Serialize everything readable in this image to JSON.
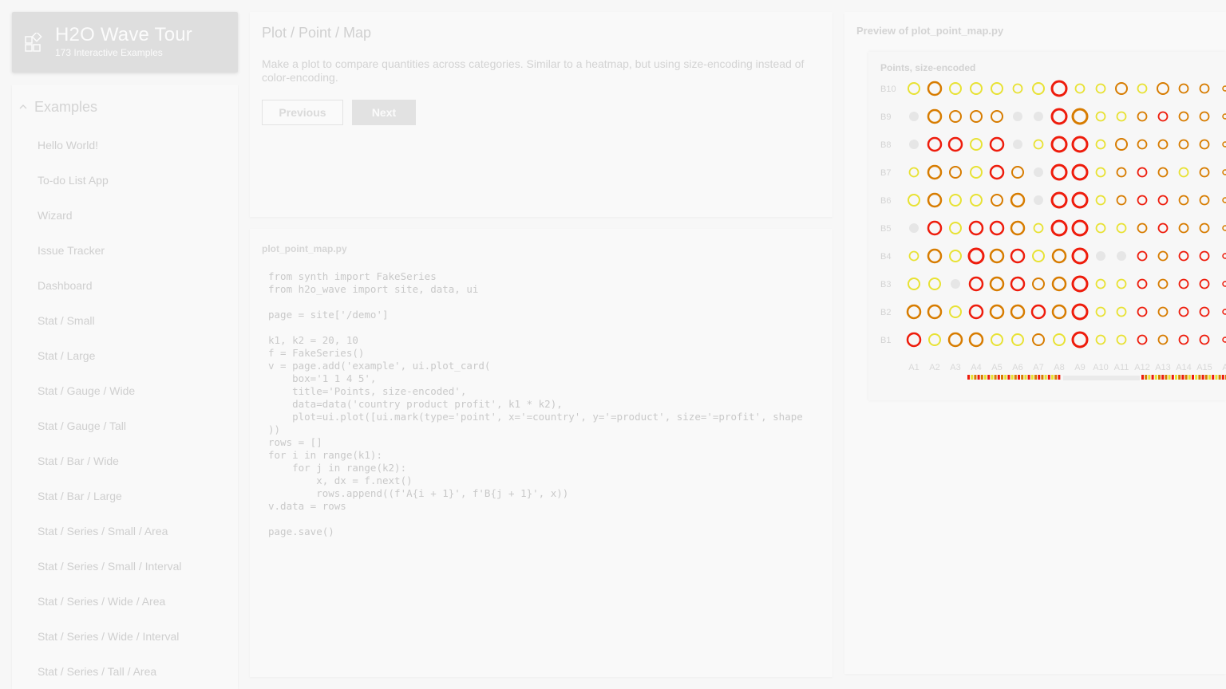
{
  "sidebar": {
    "title": "H2O Wave Tour",
    "subtitle": "173 Interactive Examples",
    "group_label": "Examples",
    "items": [
      "Hello World!",
      "To-do List App",
      "Wizard",
      "Issue Tracker",
      "Dashboard",
      "Stat / Small",
      "Stat / Large",
      "Stat / Gauge / Wide",
      "Stat / Gauge / Tall",
      "Stat / Bar / Wide",
      "Stat / Bar / Large",
      "Stat / Series / Small / Area",
      "Stat / Series / Small / Interval",
      "Stat / Series / Wide / Area",
      "Stat / Series / Wide / Interval",
      "Stat / Series / Tall / Area"
    ]
  },
  "intro": {
    "title": "Plot / Point / Map",
    "description": "Make a plot to compare quantities across categories. Similar to a heatmap, but using size-encoding instead of color-encoding.",
    "prev_label": "Previous",
    "next_label": "Next"
  },
  "code": {
    "filename": "plot_point_map.py",
    "lines": [
      "from synth import FakeSeries",
      "from h2o_wave import site, data, ui",
      "",
      "page = site['/demo']",
      "",
      "k1, k2 = 20, 10",
      "f = FakeSeries()",
      "v = page.add('example', ui.plot_card(",
      "    box='1 1 4 5',",
      "    title='Points, size-encoded',",
      "    data=data('country product profit', k1 * k2),",
      "    plot=ui.plot([ui.mark(type='point', x='=country', y='=product', size='=profit', shape",
      "))",
      "rows = []",
      "for i in range(k1):",
      "    for j in range(k2):",
      "        x, dx = f.next()",
      "        rows.append((f'A{i + 1}', f'B{j + 1}', x))",
      "v.data = rows",
      "",
      "page.save()"
    ]
  },
  "preview": {
    "label": "Preview of plot_point_map.py",
    "plot_title": "Points, size-encoded"
  },
  "colors": {
    "mark_red": "#ee1c0c",
    "mark_orange": "#d77c00",
    "mark_yellow": "#e8e234",
    "mark_gray": "#e6e6e6"
  },
  "chart_data": {
    "type": "scatter",
    "title": "Points, size-encoded",
    "x_categories": [
      "A1",
      "A2",
      "A3",
      "A4",
      "A5",
      "A6",
      "A7",
      "A8",
      "A9",
      "A10",
      "A11",
      "A12",
      "A13",
      "A14",
      "A15",
      "A16"
    ],
    "y_categories": [
      "B10",
      "B9",
      "B8",
      "B7",
      "B6",
      "B5",
      "B4",
      "B3",
      "B2",
      "B1"
    ],
    "visible_x_labels": [
      "A1",
      "A2",
      "A3",
      "A4",
      "A5",
      "A6",
      "A7",
      "A8",
      "A9",
      "A10",
      "A11",
      "A12",
      "A13",
      "A14",
      "A15",
      "A"
    ],
    "size_levels": [
      [
        3,
        4,
        3,
        3,
        3,
        2,
        3,
        5,
        2,
        2,
        3,
        2,
        3,
        2,
        2,
        1
      ],
      [
        1,
        4,
        3,
        3,
        3,
        1,
        1,
        5,
        5,
        2,
        2,
        2,
        2,
        2,
        2,
        1
      ],
      [
        1,
        4,
        4,
        3,
        4,
        1,
        2,
        5,
        5,
        2,
        3,
        2,
        2,
        2,
        2,
        1
      ],
      [
        2,
        4,
        3,
        3,
        4,
        3,
        1,
        5,
        5,
        2,
        2,
        2,
        2,
        2,
        2,
        1
      ],
      [
        3,
        4,
        3,
        3,
        3,
        4,
        1,
        5,
        5,
        2,
        2,
        2,
        2,
        2,
        2,
        1
      ],
      [
        1,
        4,
        3,
        4,
        4,
        4,
        2,
        5,
        5,
        2,
        2,
        2,
        2,
        2,
        2,
        1
      ],
      [
        2,
        4,
        3,
        5,
        4,
        4,
        3,
        4,
        5,
        1,
        1,
        2,
        2,
        2,
        2,
        1
      ],
      [
        3,
        3,
        1,
        4,
        4,
        4,
        3,
        4,
        5,
        2,
        2,
        2,
        2,
        2,
        2,
        1
      ],
      [
        4,
        4,
        3,
        4,
        4,
        4,
        4,
        4,
        5,
        2,
        2,
        2,
        2,
        2,
        2,
        1
      ],
      [
        4,
        3,
        4,
        4,
        3,
        3,
        3,
        3,
        5,
        2,
        2,
        2,
        2,
        2,
        2,
        1
      ]
    ],
    "color_levels": [
      [
        2,
        1,
        2,
        2,
        2,
        2,
        2,
        0,
        2,
        2,
        1,
        2,
        1,
        1,
        1,
        1
      ],
      [
        3,
        1,
        1,
        1,
        1,
        3,
        3,
        0,
        1,
        2,
        2,
        1,
        0,
        1,
        1,
        1
      ],
      [
        3,
        0,
        0,
        2,
        0,
        3,
        2,
        0,
        0,
        2,
        1,
        1,
        1,
        1,
        1,
        1
      ],
      [
        2,
        1,
        1,
        2,
        0,
        1,
        3,
        0,
        0,
        2,
        1,
        0,
        1,
        2,
        1,
        1
      ],
      [
        2,
        1,
        2,
        2,
        1,
        1,
        3,
        0,
        0,
        2,
        1,
        0,
        0,
        1,
        1,
        1
      ],
      [
        3,
        0,
        2,
        0,
        0,
        1,
        2,
        0,
        0,
        2,
        2,
        1,
        0,
        1,
        1,
        1
      ],
      [
        2,
        1,
        2,
        0,
        1,
        0,
        2,
        1,
        0,
        3,
        3,
        0,
        1,
        0,
        0,
        0
      ],
      [
        2,
        2,
        3,
        0,
        1,
        0,
        1,
        1,
        0,
        2,
        2,
        0,
        1,
        0,
        0,
        0
      ],
      [
        1,
        1,
        2,
        0,
        1,
        1,
        0,
        1,
        0,
        2,
        2,
        0,
        1,
        0,
        0,
        0
      ],
      [
        0,
        2,
        1,
        1,
        2,
        2,
        1,
        2,
        0,
        2,
        2,
        0,
        1,
        0,
        0,
        0
      ]
    ],
    "grid": false,
    "legend": "bottom"
  }
}
